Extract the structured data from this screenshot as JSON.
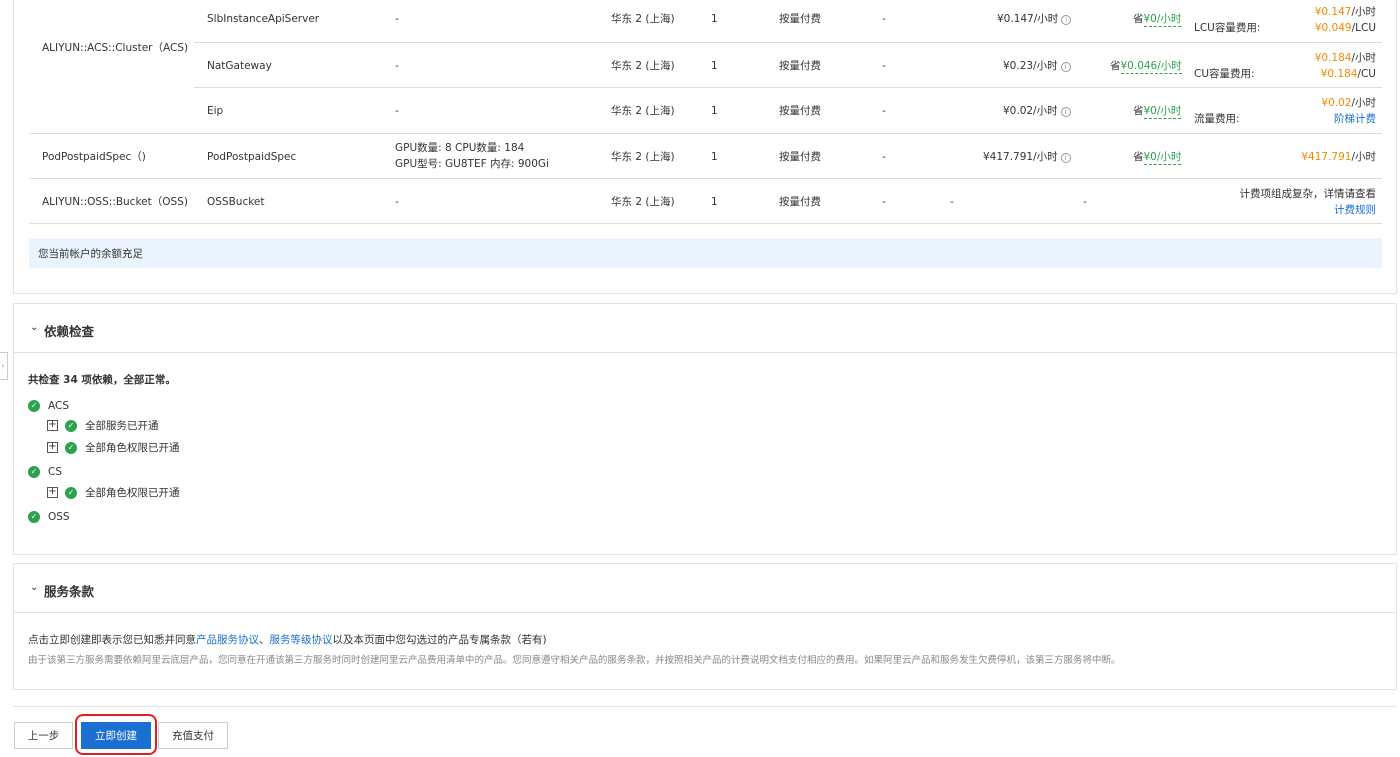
{
  "pricing": {
    "rows": [
      {
        "group": "ALIYUN::ACS::Cluster（ACS)",
        "name": "SlbInstanceApiServer",
        "spec": "-",
        "region": "华东 2 (上海)",
        "qty": "1",
        "billing": "按量付费",
        "discount": "-",
        "price": "¥0.147/小时",
        "save_prefix": "省",
        "save": "¥0/小时",
        "fee_label": "LCU容量费用:",
        "fee1_value": "¥0.147",
        "fee1_unit": "/小时",
        "fee2_value": "¥0.049",
        "fee2_unit": "/LCU"
      },
      {
        "name": "NatGateway",
        "spec": "-",
        "region": "华东 2 (上海)",
        "qty": "1",
        "billing": "按量付费",
        "discount": "-",
        "price": "¥0.23/小时",
        "save_prefix": "省",
        "save": "¥0.046/小时",
        "fee_label": "CU容量费用:",
        "fee1_value": "¥0.184",
        "fee1_unit": "/小时",
        "fee2_value": "¥0.184",
        "fee2_unit": "/CU"
      },
      {
        "name": "Eip",
        "spec": "-",
        "region": "华东 2 (上海)",
        "qty": "1",
        "billing": "按量付费",
        "discount": "-",
        "price": "¥0.02/小时",
        "save_prefix": "省",
        "save": "¥0/小时",
        "fee_label": "流量费用:",
        "fee1_value": "¥0.02",
        "fee1_unit": "/小时",
        "fee_link": "阶梯计费"
      },
      {
        "group": "PodPostpaidSpec（)",
        "name": "PodPostpaidSpec",
        "spec_line1": "GPU数量: 8     CPU数量: 184",
        "spec_line2": "GPU型号: GU8TEF 内存: 900Gi",
        "region": "华东 2 (上海)",
        "qty": "1",
        "billing": "按量付费",
        "discount": "-",
        "price": "¥417.791/小时",
        "save_prefix": "省",
        "save": "¥0/小时",
        "fee1_value": "¥417.791",
        "fee1_unit": "/小时"
      },
      {
        "group": "ALIYUN::OSS::Bucket（OSS)",
        "name": "OSSBucket",
        "spec": "-",
        "region": "华东 2 (上海)",
        "qty": "1",
        "billing": "按量付费",
        "discount": "-",
        "price": "-",
        "save": "-",
        "fee_text": "计费项组成复杂，详情请查看",
        "fee_link": "计费规则"
      }
    ],
    "balance_notice": "您当前帐户的余额充足"
  },
  "deps": {
    "title": "依赖检查",
    "summary": "共检查 34 项依赖，全部正常。",
    "items": [
      {
        "label": "ACS"
      },
      {
        "label": "全部服务已开通"
      },
      {
        "label": "全部角色权限已开通"
      },
      {
        "label": "CS"
      },
      {
        "label": "全部角色权限已开通"
      },
      {
        "label": "OSS"
      }
    ]
  },
  "terms": {
    "title": "服务条款",
    "line1_prefix": "点击立即创建即表示您已知悉并同意",
    "link1": "产品服务协议",
    "sep": "、",
    "link2": "服务等级协议",
    "line1_suffix": "以及本页面中您勾选过的产品专属条款（若有)",
    "line2": "由于该第三方服务需要依赖阿里云底层产品，您同意在开通该第三方服务时同时创建阿里云产品费用清单中的产品。您同意遵守相关产品的服务条款，并按照相关产品的计费说明文档支付相应的费用。如果阿里云产品和服务发生欠费停机，该第三方服务将中断。"
  },
  "actions": {
    "prev": "上一步",
    "create": "立即创建",
    "recharge": "充值支付"
  },
  "icons": {
    "info": "info-icon",
    "chevron": "chevron-down-icon",
    "check": "check-circle-icon",
    "expand": "plus-square-icon"
  },
  "colors": {
    "primary": "#1a6fd1",
    "orange": "#f28a00",
    "green": "#2ba24c",
    "notice_bg": "#eaf4fe",
    "highlight": "#e02020"
  }
}
